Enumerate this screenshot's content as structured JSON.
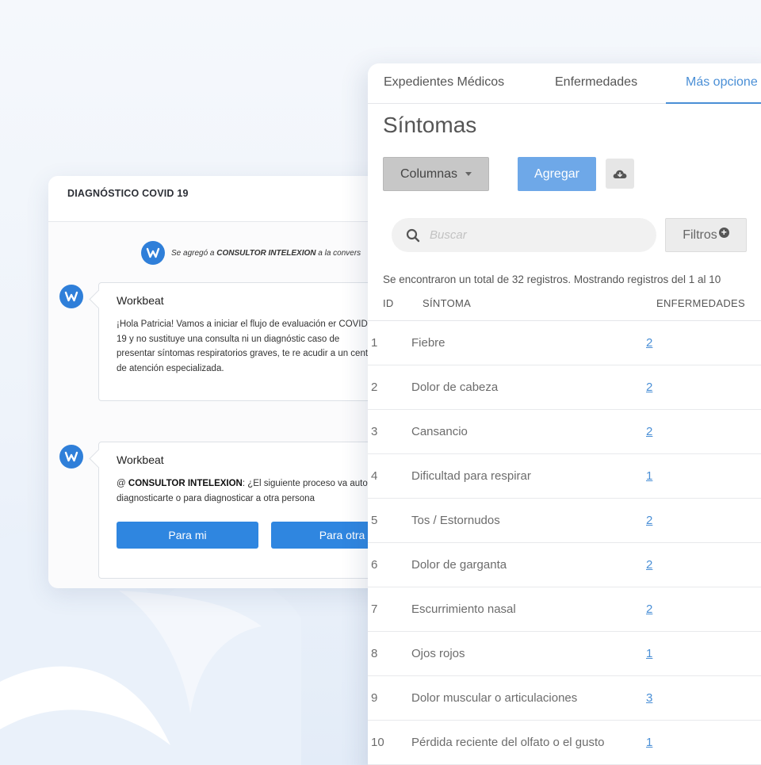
{
  "chat": {
    "header": "DIAGNÓSTICO COVID 19",
    "system_prefix": "Se agregó a",
    "system_bold": "CONSULTOR INTELEXION",
    "system_suffix": "a la convers",
    "messages": [
      {
        "sender": "Workbeat",
        "text": "¡Hola Patricia! Vamos a iniciar el flujo de evaluación er COVID-19 y no sustituye una consulta ni un diagnóstic caso de presentar síntomas respiratorios graves, te re acudir a un centro de atención especializada."
      },
      {
        "sender": "Workbeat",
        "mention_prefix": "@",
        "mention": "CONSULTOR INTELEXION",
        "text": ": ¿El siguiente proceso va auto diagnosticarte o para diagnosticar a otra persona",
        "buttons": [
          "Para mi",
          "Para otra"
        ]
      }
    ]
  },
  "panel": {
    "tabs": [
      {
        "label": "Expedientes Médicos",
        "active": false
      },
      {
        "label": "Enfermedades",
        "active": false
      },
      {
        "label": "Más opcione",
        "active": true
      }
    ],
    "title": "Síntomas",
    "columns_button": "Columnas",
    "add_button": "Agregar",
    "cloud_icon": "cloud-download-icon",
    "search_placeholder": "Buscar",
    "filters_button": "Filtros",
    "summary": "Se encontraron un total de 32 registros. Mostrando registros del 1 al 10",
    "table": {
      "headers": [
        "ID",
        "SÍNTOMA",
        "ENFERMEDADES"
      ],
      "rows": [
        {
          "id": "1",
          "symptom": "Fiebre",
          "diseases": "2"
        },
        {
          "id": "2",
          "symptom": "Dolor de cabeza",
          "diseases": "2"
        },
        {
          "id": "3",
          "symptom": "Cansancio",
          "diseases": "2"
        },
        {
          "id": "4",
          "symptom": "Dificultad para respirar",
          "diseases": "1"
        },
        {
          "id": "5",
          "symptom": "Tos / Estornudos",
          "diseases": "2"
        },
        {
          "id": "6",
          "symptom": "Dolor de garganta",
          "diseases": "2"
        },
        {
          "id": "7",
          "symptom": "Escurrimiento nasal",
          "diseases": "2"
        },
        {
          "id": "8",
          "symptom": "Ojos rojos",
          "diseases": "1"
        },
        {
          "id": "9",
          "symptom": "Dolor muscular o articulaciones",
          "diseases": "3"
        },
        {
          "id": "10",
          "symptom": "Pérdida reciente del olfato o el gusto",
          "diseases": "1"
        }
      ]
    }
  },
  "colors": {
    "accent": "#4a8fd6",
    "chat_button": "#2f86e0",
    "logo": "#2f7fd9"
  }
}
